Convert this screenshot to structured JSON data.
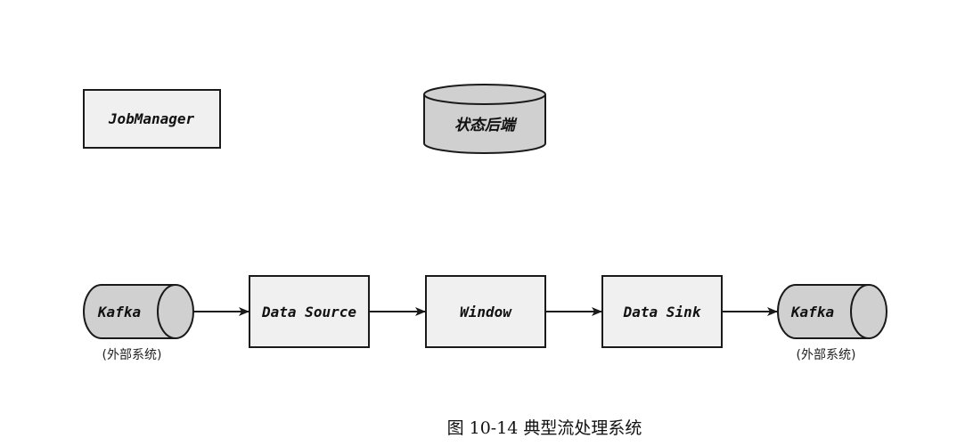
{
  "diagram": {
    "job_manager": "JobManager",
    "state_backend": "状态后端",
    "kafka_source": {
      "label": "Kafka",
      "note": "(外部系统)"
    },
    "data_source": "Data Source",
    "window": "Window",
    "data_sink": "Data Sink",
    "kafka_sink": {
      "label": "Kafka",
      "note": "(外部系统)"
    }
  },
  "caption": "图 10-14  典型流处理系统"
}
